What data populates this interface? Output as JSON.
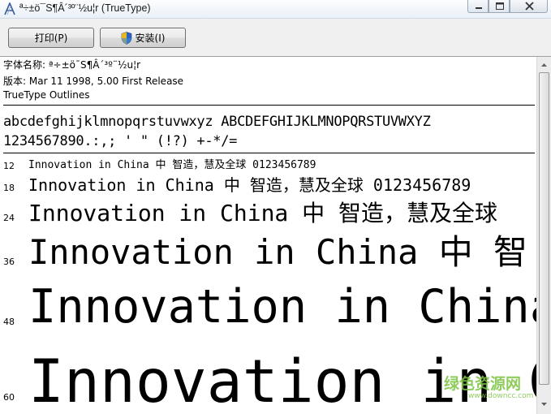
{
  "window": {
    "title": "ª÷±ö¯S¶Â´³º¨½u¦r (TrueType)",
    "icon": "font-a-icon",
    "controls": [
      "minimize-icon",
      "maximize-icon",
      "close-icon"
    ]
  },
  "toolbar": {
    "print_label": "打印(P)",
    "install_label": "安装(I)",
    "install_icon": "uac-shield-icon"
  },
  "info": {
    "font_name": "字体名称: ª÷±ö¯S¶Â´³º¨½u¦r",
    "version": "版本: Mar 11 1998, 5.00 First Release",
    "outlines": "TrueType Outlines"
  },
  "charset": {
    "line1": "abcdefghijklmnopqrstuvwxyz ABCDEFGHIJKLMNOPQRSTUVWXYZ",
    "line2": "1234567890.:,; ' \" (!?) +-*/="
  },
  "samples": [
    {
      "size": "12",
      "text": "Innovation in China 中  智造，慧及全球 0123456789"
    },
    {
      "size": "18",
      "text": "Innovation in China 中  智造，慧及全球 0123456789"
    },
    {
      "size": "24",
      "text": "Innovation in China 中  智造，慧及全球"
    },
    {
      "size": "36",
      "text": "Innovation in China 中  智"
    },
    {
      "size": "48",
      "text": "Innovation in China"
    },
    {
      "size": "60",
      "text": "Innovation in Ch"
    }
  ],
  "watermark": {
    "main": "绿色资源网",
    "sub": "www.downcc.com"
  },
  "colors": {
    "watermark": "#7cc442",
    "toolbar_bg": "#f0f0f0"
  }
}
